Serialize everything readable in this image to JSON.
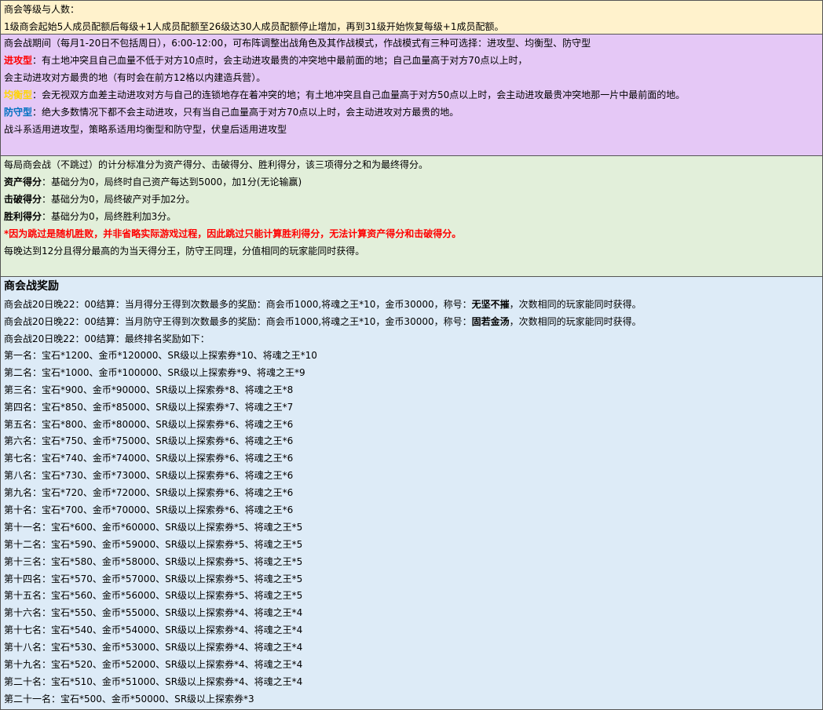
{
  "block1": {
    "line1": "商会等级与人数：",
    "line2": "1级商会起始5人成员配额后每级+1人成员配额至26级达30人成员配额停止增加，再到31级开始恢复每级+1成员配额。"
  },
  "block2": {
    "line1": "商会战期间（每月1-20日不包括周日），6:00-12:00，可布阵调整出战角色及其作战模式，作战模式有三种可选择：进攻型、均衡型、防守型",
    "attack_label": "进攻型",
    "attack_text": "：有土地冲突且自己血量不低于对方10点时，会主动进攻最贵的冲突地中最前面的地；自己血量高于对方70点以上时，",
    "attack_text2": "会主动进攻对方最贵的地（有时会在前方12格以内建造兵营）。",
    "balance_label": "均衡型",
    "balance_text": "：会无视双方血差主动进攻对方与自己的连锁地存在着冲突的地；有土地冲突且自己血量高于对方50点以上时，会主动进攻最贵冲突地那一片中最前面的地。",
    "defense_label": "防守型",
    "defense_text": "：绝大多数情况下都不会主动进攻，只有当自己血量高于对方70点以上时，会主动进攻对方最贵的地。",
    "note": "战斗系适用进攻型，策略系适用均衡型和防守型，伏皇后适用进攻型"
  },
  "block3": {
    "line1": "每局商会战（不跳过）的计分标准分为资产得分、击破得分、胜利得分，该三项得分之和为最终得分。",
    "asset_label": "资产得分",
    "asset_text": "：基础分为0，局终时自己资产每达到5000，加1分(无论输赢)",
    "break_label": "击破得分",
    "break_text": "：基础分为0，局终破产对手加2分。",
    "win_label": "胜利得分",
    "win_text": "：基础分为0，局终胜利加3分。",
    "warning": "*因为跳过是随机胜败，并非省略实际游戏过程，因此跳过只能计算胜利得分，无法计算资产得分和击破得分。",
    "last": "每晚达到12分且得分最高的为当天得分王，防守王同理，分值相同的玩家能同时获得。"
  },
  "block4": {
    "title": "商会战奖励",
    "r1_pre": "商会战20日晚22：00结算：当月得分王得到次数最多的奖励：商会币1000,将魂之王*10，金币30000，称号：",
    "r1_title": "无坚不摧",
    "r1_post": "，次数相同的玩家能同时获得。",
    "r2_pre": "商会战20日晚22：00结算：当月防守王得到次数最多的奖励：商会币1000,将魂之王*10，金币30000，称号：",
    "r2_title": "固若金汤",
    "r2_post": "，次数相同的玩家能同时获得。",
    "r3": "商会战20日晚22：00结算：最终排名奖励如下：",
    "ranks": [
      "第一名：宝石*1200、金币*120000、SR级以上探索券*10、将魂之王*10",
      "第二名：宝石*1000、金币*100000、SR级以上探索券*9、将魂之王*9",
      "第三名：宝石*900、金币*90000、SR级以上探索券*8、将魂之王*8",
      "第四名：宝石*850、金币*85000、SR级以上探索券*7、将魂之王*7",
      "第五名：宝石*800、金币*80000、SR级以上探索券*6、将魂之王*6",
      "第六名：宝石*750、金币*75000、SR级以上探索券*6、将魂之王*6",
      "第七名：宝石*740、金币*74000、SR级以上探索券*6、将魂之王*6",
      "第八名：宝石*730、金币*73000、SR级以上探索券*6、将魂之王*6",
      "第九名：宝石*720、金币*72000、SR级以上探索券*6、将魂之王*6",
      "第十名：宝石*700、金币*70000、SR级以上探索券*6、将魂之王*6",
      "第十一名：宝石*600、金币*60000、SR级以上探索券*5、将魂之王*5",
      "第十二名：宝石*590、金币*59000、SR级以上探索券*5、将魂之王*5",
      "第十三名：宝石*580、金币*58000、SR级以上探索券*5、将魂之王*5",
      "第十四名：宝石*570、金币*57000、SR级以上探索券*5、将魂之王*5",
      "第十五名：宝石*560、金币*56000、SR级以上探索券*5、将魂之王*5",
      "第十六名：宝石*550、金币*55000、SR级以上探索券*4、将魂之王*4",
      "第十七名：宝石*540、金币*54000、SR级以上探索券*4、将魂之王*4",
      "第十八名：宝石*530、金币*53000、SR级以上探索券*4、将魂之王*4",
      "第十九名：宝石*520、金币*52000、SR级以上探索券*4、将魂之王*4",
      "第二十名：宝石*510、金币*51000、SR级以上探索券*4、将魂之王*4",
      "第二十一名：宝石*500、金币*50000、SR级以上探索券*3"
    ]
  }
}
